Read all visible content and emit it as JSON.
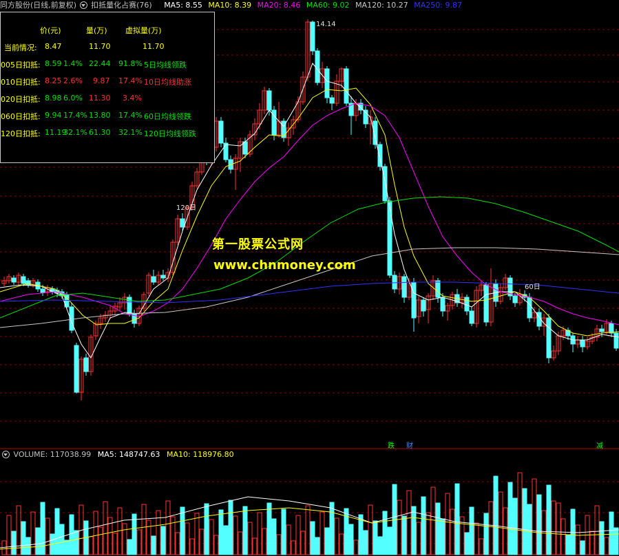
{
  "header": {
    "title": "同方股份(日线,前复权)",
    "indicator": "扣抵量化占赛(76)",
    "ma5": "MA5: 8.55",
    "ma10": "MA10: 8.39",
    "ma20": "MA20: 8.46",
    "ma60": "MA60: 9.02",
    "ma120": "MA120: 10.27",
    "ma250": "MA250: 9.87"
  },
  "colors": {
    "up": "#ff3232",
    "down": "#54ffff",
    "ma5": "#ffffff",
    "ma10": "#ffff00",
    "ma20": "#ff00ff",
    "ma60": "#00e000",
    "ma120": "#c8c8c8",
    "ma250": "#3232ff",
    "grid": "#8b0000",
    "text_yellow": "#ffff00",
    "text_green": "#00e000",
    "text_red": "#ff3232"
  },
  "info_table": {
    "headers": [
      "价(元)",
      "量(万)",
      "虚拟量(万)"
    ],
    "current": {
      "label": "当前情况:",
      "price": "8.47",
      "vol": "11.70",
      "virt": "11.70"
    },
    "rows": [
      {
        "label": "005日扣抵:",
        "price": "8.59",
        "pct": "1.4%",
        "vol": "22.44",
        "ratio": "91.8%",
        "note": "5日均线领跌",
        "tone": "green"
      },
      {
        "label": "010日扣抵:",
        "price": "8.25",
        "pct": "2.6%",
        "vol": "9.87",
        "ratio": "17.4%",
        "note": "10日均线助涨",
        "tone": "red"
      },
      {
        "label": "020日扣抵:",
        "price": "8.98",
        "pct": "6.0%",
        "vol": "11.30",
        "ratio": "3.4%",
        "note": "",
        "tone": "mixed"
      },
      {
        "label": "060日扣抵:",
        "price": "9.94",
        "pct": "17.4%",
        "vol": "13.80",
        "ratio": "17.4%",
        "note": "60日均线领跌",
        "tone": "green"
      },
      {
        "label": "120日扣抵:",
        "price": "11.19",
        "pct": "32.1%",
        "vol": "61.30",
        "ratio": "32.1%",
        "note": "120日均线领跌",
        "tone": "green"
      }
    ]
  },
  "annotations": {
    "high": "14.14",
    "label_120": "120日",
    "label_60": "60日",
    "tag_die": "跌",
    "tag_cai": "财",
    "tag_jian": "减"
  },
  "watermark": {
    "line1": "第一股票公式网",
    "line2": "www.chnmoney.com"
  },
  "volume": {
    "label": "VOLUME: 117038.99",
    "ma5": "MA5: 148747.63",
    "ma10": "MA10: 118976.80"
  }
}
